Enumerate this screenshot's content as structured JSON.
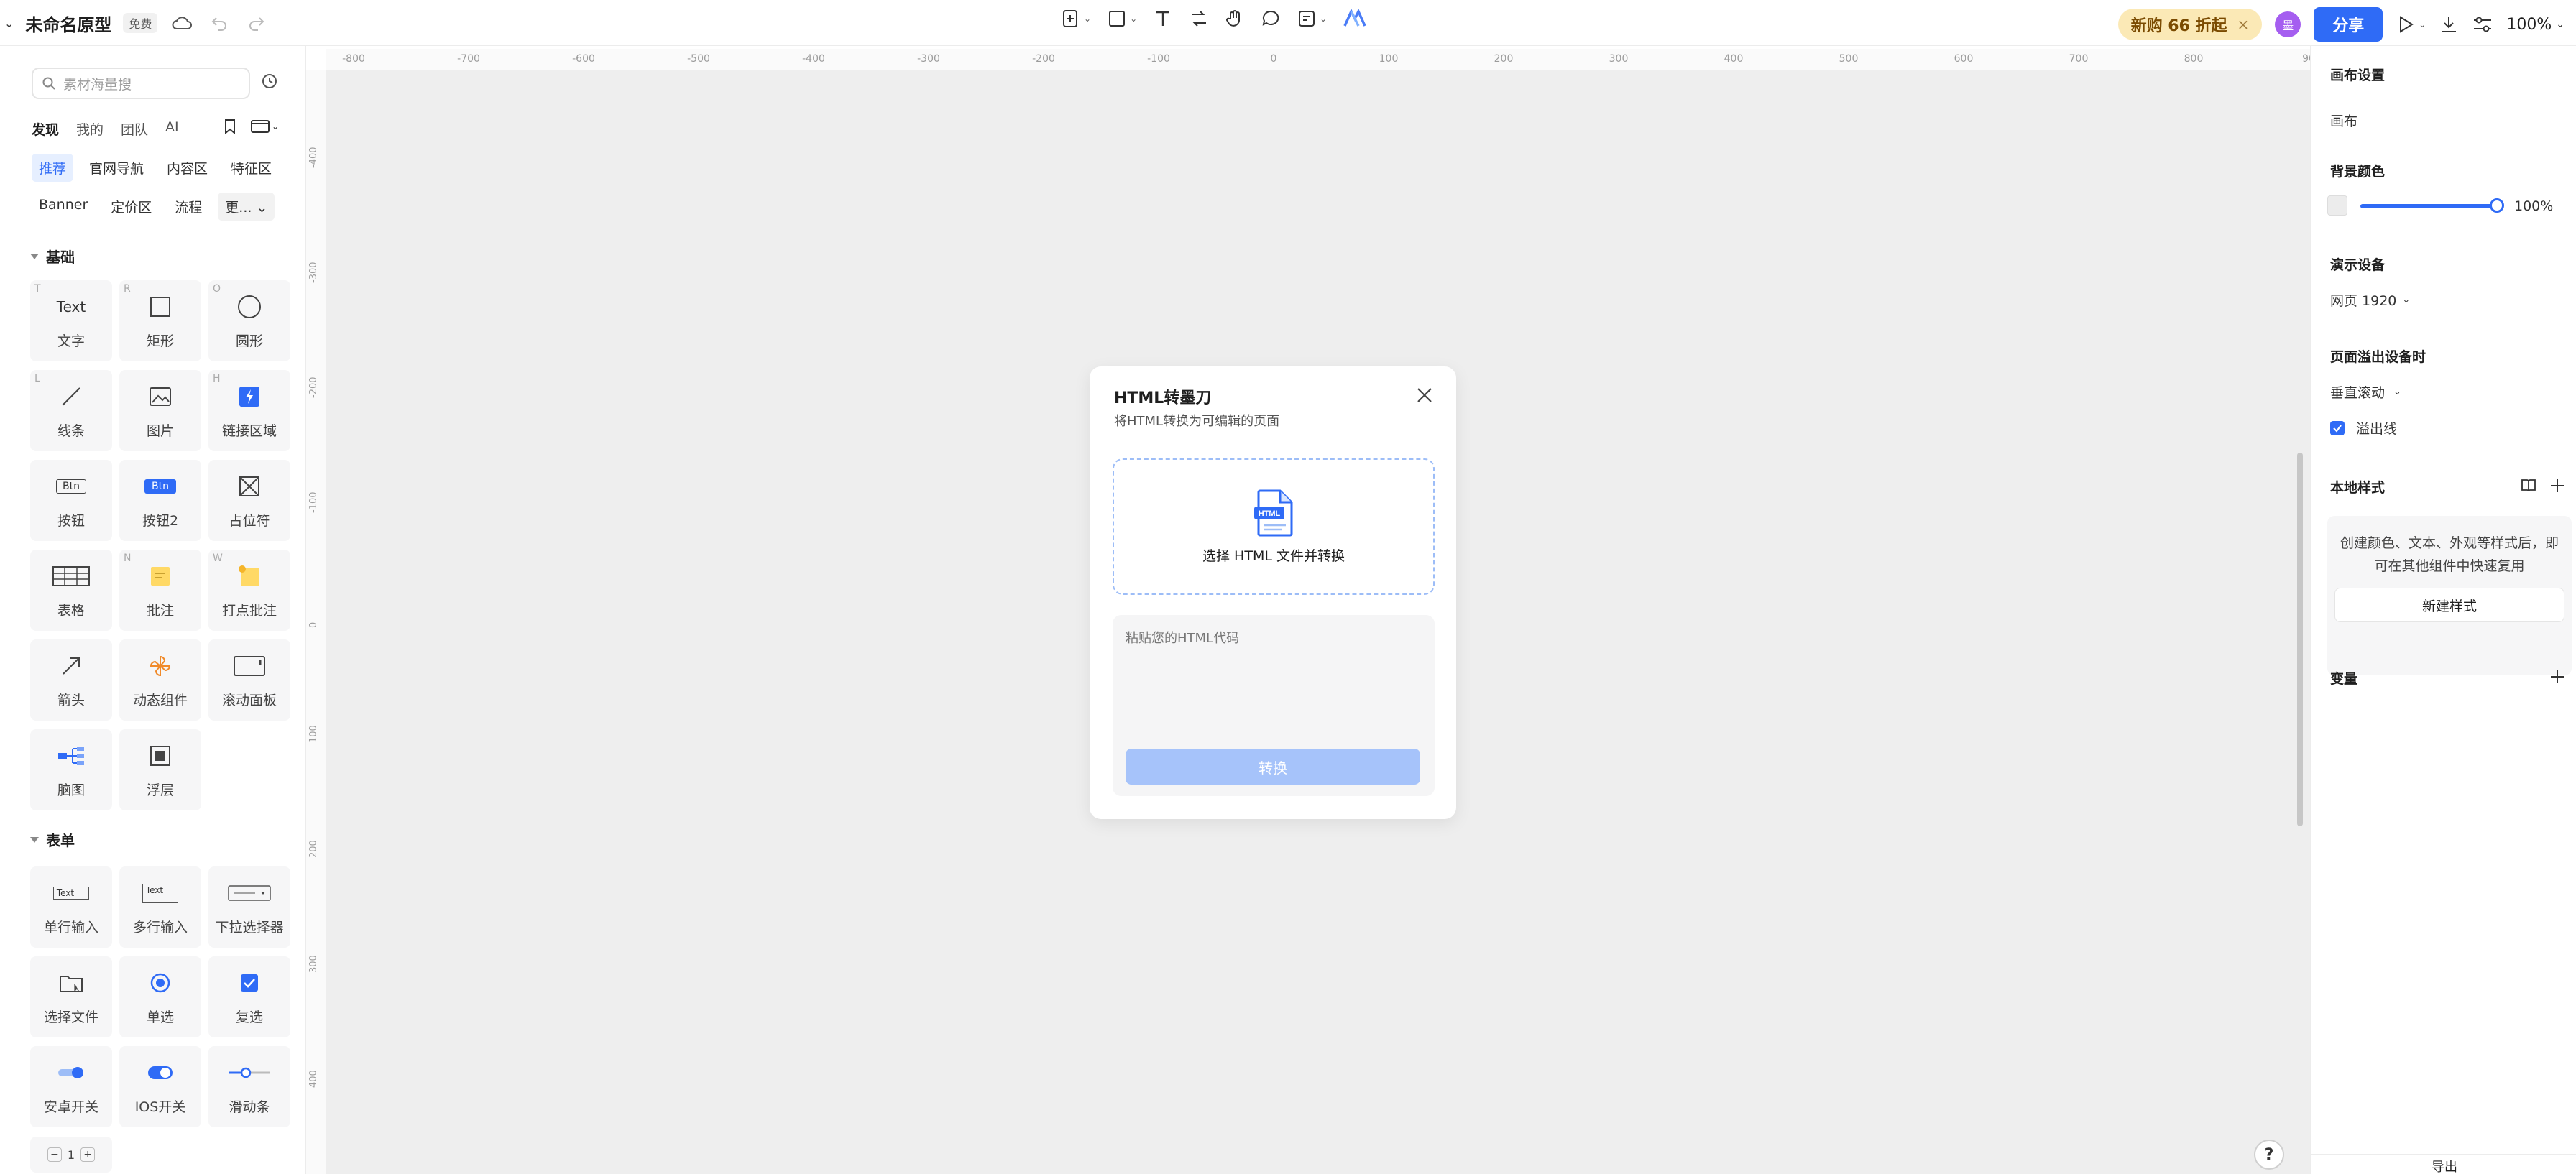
{
  "app": {
    "doc_title": "未命名原型",
    "free_badge": "免费"
  },
  "topbar": {
    "promo_label": "新购 66 折起",
    "avatar_initial": "墨",
    "share_label": "分享",
    "zoom_label": "100%"
  },
  "library": {
    "search_placeholder": "素材海量搜",
    "scope_tabs": [
      "发现",
      "我的",
      "团队",
      "AI"
    ],
    "category_chips_row1": [
      "推荐",
      "官网导航",
      "内容区",
      "特征区"
    ],
    "category_chips_row2": [
      "Banner",
      "定价区",
      "流程",
      "更..."
    ],
    "sections": {
      "basic": {
        "title": "基础",
        "items": [
          {
            "label": "文字",
            "hotkey": "T",
            "preview_text": "Text"
          },
          {
            "label": "矩形",
            "hotkey": "R"
          },
          {
            "label": "圆形",
            "hotkey": "O"
          },
          {
            "label": "线条",
            "hotkey": "L"
          },
          {
            "label": "图片",
            "hotkey": ""
          },
          {
            "label": "链接区域",
            "hotkey": "H"
          },
          {
            "label": "按钮",
            "hotkey": "",
            "preview_text": "Btn"
          },
          {
            "label": "按钮2",
            "hotkey": "",
            "preview_text": "Btn"
          },
          {
            "label": "占位符",
            "hotkey": ""
          },
          {
            "label": "表格",
            "hotkey": ""
          },
          {
            "label": "批注",
            "hotkey": "N"
          },
          {
            "label": "打点批注",
            "hotkey": "W"
          },
          {
            "label": "箭头",
            "hotkey": ""
          },
          {
            "label": "动态组件",
            "hotkey": ""
          },
          {
            "label": "滚动面板",
            "hotkey": ""
          },
          {
            "label": "脑图",
            "hotkey": ""
          },
          {
            "label": "浮层",
            "hotkey": ""
          }
        ]
      },
      "form": {
        "title": "表单",
        "items": [
          {
            "label": "单行输入",
            "preview_text": "Text"
          },
          {
            "label": "多行输入",
            "preview_text": "Text"
          },
          {
            "label": "下拉选择器"
          },
          {
            "label": "选择文件"
          },
          {
            "label": "单选"
          },
          {
            "label": "复选"
          },
          {
            "label": "安卓开关"
          },
          {
            "label": "IOS开关"
          },
          {
            "label": "滑动条"
          }
        ],
        "stepper_value": "1"
      }
    }
  },
  "ruler": {
    "h_ticks": [
      "-800",
      "-700",
      "-600",
      "-500",
      "-400",
      "-300",
      "-200",
      "-100",
      "0",
      "100",
      "200",
      "300",
      "400",
      "500",
      "600",
      "700",
      "800",
      "90"
    ],
    "v_ticks": [
      "-400",
      "-300",
      "-200",
      "-100",
      "0",
      "100",
      "200",
      "300",
      "400"
    ]
  },
  "dialog": {
    "title": "HTML转墨刀",
    "subtitle": "将HTML转换为可编辑的页面",
    "file_icon_text": "HTML",
    "dropzone_label": "选择 HTML 文件并转换",
    "code_placeholder": "粘贴您的HTML代码",
    "convert_label": "转换"
  },
  "inspector": {
    "canvas_settings": "画布设置",
    "canvas_label": "画布",
    "bg_color_label": "背景颜色",
    "bg_opacity": "100%",
    "bg_opacity_value": 1.0,
    "device_label": "演示设备",
    "device_value": "网页 1920",
    "overflow_label": "页面溢出设备时",
    "overflow_value": "垂直滚动",
    "overflow_line_label": "溢出线",
    "overflow_line_checked": true,
    "local_styles_label": "本地样式",
    "local_styles_desc": "创建颜色、文本、外观等样式后，即可在其他组件中快速复用",
    "new_style_label": "新建样式",
    "variables_label": "变量",
    "export_label": "导出"
  },
  "colors": {
    "accent": "#2f6bf6",
    "canvas_bg": "#eeeeee",
    "promo_bg": "#fbe9b6"
  }
}
